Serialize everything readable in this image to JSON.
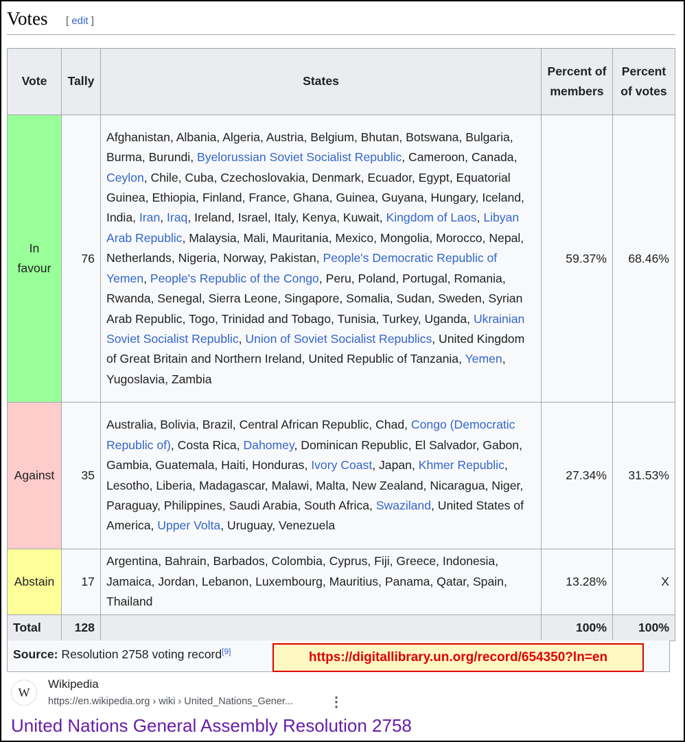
{
  "section": {
    "title": "Votes",
    "edit_open": "[ ",
    "edit_label": "edit",
    "edit_close": " ]"
  },
  "table": {
    "headers": {
      "vote": "Vote",
      "tally": "Tally",
      "states": "States",
      "pct_members": "Percent of members",
      "pct_votes": "Percent of votes"
    },
    "rows": [
      {
        "vote": "In favour",
        "tally": "76",
        "pct_members": "59.37%",
        "pct_votes": "68.46%",
        "color": "#99ff99",
        "states": [
          {
            "t": "Afghanistan, Albania, Algeria, Austria, Belgium, Bhutan, Botswana, Bulgaria, Burma, Burundi, "
          },
          {
            "t": "Byelorussian Soviet Socialist Republic",
            "link": true
          },
          {
            "t": ", Cameroon, Canada, "
          },
          {
            "t": "Ceylon",
            "link": true
          },
          {
            "t": ", Chile, Cuba, Czechoslovakia, Denmark, Ecuador, Egypt, Equatorial Guinea, Ethiopia, Finland, France, Ghana, Guinea, Guyana, Hungary, Iceland, India, "
          },
          {
            "t": "Iran",
            "link": true
          },
          {
            "t": ", "
          },
          {
            "t": "Iraq",
            "link": true
          },
          {
            "t": ", Ireland, Israel, Italy, Kenya, Kuwait, "
          },
          {
            "t": "Kingdom of Laos",
            "link": true
          },
          {
            "t": ", "
          },
          {
            "t": "Libyan Arab Republic",
            "link": true
          },
          {
            "t": ", Malaysia, Mali, Mauritania, Mexico, Mongolia, Morocco, Nepal, Netherlands, Nigeria, Norway, Pakistan, "
          },
          {
            "t": "People's Democratic Republic of Yemen",
            "link": true
          },
          {
            "t": ", "
          },
          {
            "t": "People's Republic of the Congo",
            "link": true
          },
          {
            "t": ", Peru, Poland, Portugal, Romania, Rwanda, Senegal, Sierra Leone, Singapore, Somalia, Sudan, Sweden, Syrian Arab Republic, Togo, Trinidad and Tobago, Tunisia, Turkey, Uganda, "
          },
          {
            "t": "Ukrainian Soviet Socialist Republic",
            "link": true
          },
          {
            "t": ", "
          },
          {
            "t": "Union of Soviet Socialist Republics",
            "link": true
          },
          {
            "t": ", United Kingdom of Great Britain and Northern Ireland, United Republic of Tanzania, "
          },
          {
            "t": "Yemen",
            "link": true
          },
          {
            "t": ", Yugoslavia, Zambia"
          }
        ]
      },
      {
        "vote": "Against",
        "tally": "35",
        "pct_members": "27.34%",
        "pct_votes": "31.53%",
        "color": "#ffcccc",
        "states": [
          {
            "t": "Australia, Bolivia, Brazil, Central African Republic, Chad, "
          },
          {
            "t": "Congo (Democratic Republic of)",
            "link": true
          },
          {
            "t": ", Costa Rica, "
          },
          {
            "t": "Dahomey",
            "link": true
          },
          {
            "t": ", Dominican Republic, El Salvador, Gabon, Gambia, Guatemala, Haiti, Honduras, "
          },
          {
            "t": "Ivory Coast",
            "link": true
          },
          {
            "t": ", Japan, "
          },
          {
            "t": "Khmer Republic",
            "link": true
          },
          {
            "t": ", Lesotho, Liberia, Madagascar, Malawi, Malta, New Zealand, Nicaragua, Niger, Paraguay, Philippines, Saudi Arabia, South Africa, "
          },
          {
            "t": "Swaziland",
            "link": true
          },
          {
            "t": ", United States of America, "
          },
          {
            "t": "Upper Volta",
            "link": true
          },
          {
            "t": ", Uruguay, Venezuela"
          }
        ]
      },
      {
        "vote": "Abstain",
        "tally": "17",
        "pct_members": "13.28%",
        "pct_votes": "X",
        "color": "#ffff99",
        "states": [
          {
            "t": "Argentina, Bahrain, Barbados, Colombia, Cyprus, Fiji, Greece, Indonesia, Jamaica, Jordan, Lebanon, Luxembourg, Mauritius, Panama, Qatar, Spain, Thailand"
          }
        ]
      }
    ],
    "total": {
      "label": "Total",
      "tally": "128",
      "pct_members": "100%",
      "pct_votes": "100%"
    }
  },
  "source": {
    "label": "Source:",
    "text": " Resolution 2758 voting record",
    "ref": "[9]"
  },
  "highlight_url": "https://digitallibrary.un.org/record/654350?ln=en",
  "search_result": {
    "favicon_letter": "W",
    "site_name": "Wikipedia",
    "site_url": "https://en.wikipedia.org › wiki › United_Nations_Gener...",
    "menu_glyph": "⋮",
    "title": "United Nations General Assembly Resolution 2758"
  }
}
